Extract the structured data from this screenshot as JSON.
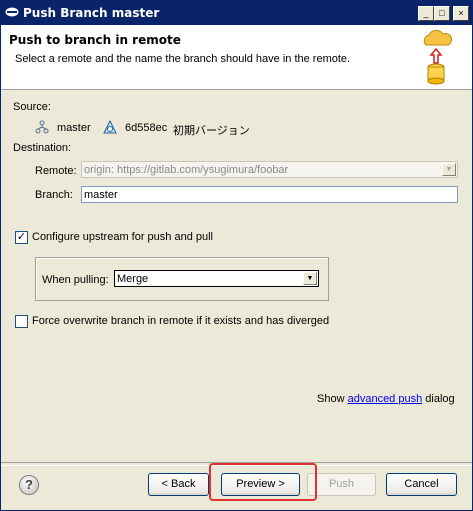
{
  "window": {
    "title": "Push Branch master",
    "buttons": {
      "minimize": "_",
      "maximize": "□",
      "close": "×"
    }
  },
  "header": {
    "title": "Push to branch in remote",
    "description": "Select a remote and the name the branch should have in the remote."
  },
  "source": {
    "label": "Source:",
    "branch_name": "master",
    "commit_id": "6d558ec",
    "commit_message": "初期バージョン"
  },
  "destination": {
    "label": "Destination:",
    "remote_label": "Remote:",
    "remote_value": "origin: https://gitlab.com/ysugimura/foobar",
    "branch_label": "Branch:",
    "branch_value": "master"
  },
  "upstream": {
    "label": "Configure upstream for push and pull",
    "checked": true,
    "when_pulling_label": "When pulling:",
    "when_pulling_value": "Merge"
  },
  "force": {
    "label": "Force overwrite branch in remote if it exists and has diverged",
    "checked": false
  },
  "advanced": {
    "prefix": "Show",
    "link": "advanced push",
    "suffix": "dialog"
  },
  "buttons": {
    "help": "?",
    "back": "< Back",
    "preview": "Preview >",
    "push": "Push",
    "cancel": "Cancel"
  },
  "icons": [
    "window-icon",
    "branch-icon",
    "commit-icon",
    "cloud-push-icon",
    "help-icon",
    "checkmark-icon",
    "dropdown-arrow-icon"
  ],
  "colors": {
    "titlebar": "#0a246a",
    "highlight": "#e53030",
    "link": "#0000ee"
  }
}
